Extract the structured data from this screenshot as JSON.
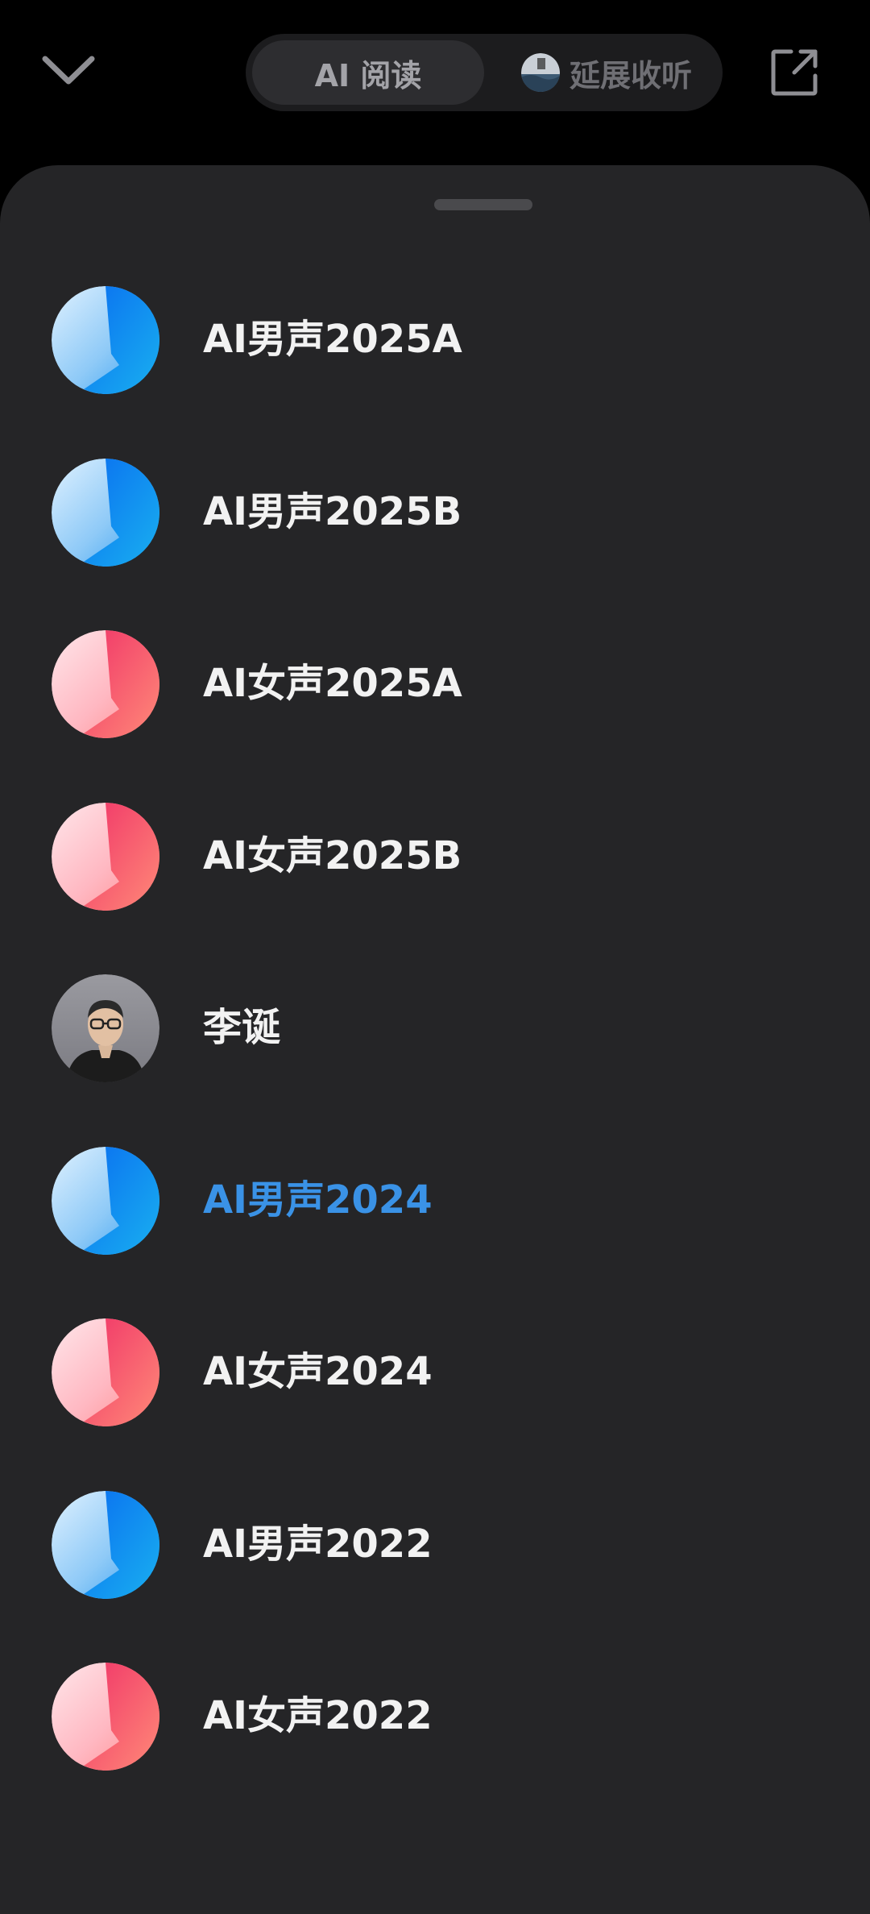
{
  "header": {
    "collapse_icon": "chevron-down-icon",
    "tabs": [
      {
        "label": "AI 阅读",
        "active": true
      },
      {
        "label": "延展收听",
        "active": false,
        "icon": "podcast-thumbnail"
      }
    ],
    "share_icon": "share-external-icon"
  },
  "voices": [
    {
      "label": "AI男声2025A",
      "avatar": "male",
      "selected": false
    },
    {
      "label": "AI男声2025B",
      "avatar": "male",
      "selected": false
    },
    {
      "label": "AI女声2025A",
      "avatar": "female",
      "selected": false
    },
    {
      "label": "AI女声2025B",
      "avatar": "female",
      "selected": false
    },
    {
      "label": "李诞",
      "avatar": "photo",
      "selected": false
    },
    {
      "label": "AI男声2024",
      "avatar": "male",
      "selected": true
    },
    {
      "label": "AI女声2024",
      "avatar": "female",
      "selected": false
    },
    {
      "label": "AI男声2022",
      "avatar": "male",
      "selected": false
    },
    {
      "label": "AI女声2022",
      "avatar": "female",
      "selected": false
    }
  ],
  "colors": {
    "background": "#000000",
    "sheet": "#252527",
    "selected_text": "#3a92e6",
    "text": "#f2f2f2",
    "male_gradient": [
      "#c9e8ff",
      "#1479f0"
    ],
    "female_gradient": [
      "#ffd7dc",
      "#f2406e"
    ]
  }
}
